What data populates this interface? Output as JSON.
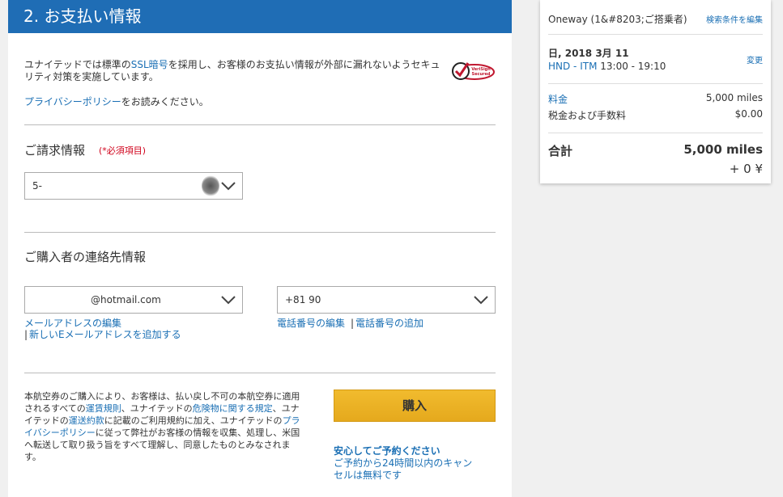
{
  "payment": {
    "header": "2. お支払い情報",
    "ssl": {
      "prefix": "ユナイテッドでは標準の",
      "link": "SSL暗号",
      "line1_suffix": "を採用し、お客様のお支払い情報が外部に漏れないようセキュ",
      "line2": "リティ対策を実施しています。"
    },
    "privacy": {
      "link": "プライバシーポリシー",
      "suffix": "をお読みください。"
    },
    "badge_text": "VeriSign Secured",
    "billing": {
      "title": "ご請求情報",
      "required_note": "(*必須項目)",
      "select_value": "5-"
    },
    "contact": {
      "title": "ご購入者の連絡先情報",
      "email_value": "@hotmail.com",
      "phone_value": "+81 90",
      "edit_email": "メールアドレスの編集",
      "add_email": "新しいEメールアドレスを追加する",
      "edit_phone": "電話番号の編集",
      "add_phone": "電話番号の追加",
      "separator": "|"
    },
    "terms": {
      "line1": "本航空券のご購入により、お客様は、払い戻し不可の本航空券に適用",
      "line2_a": "されるすべての",
      "line2_link1": "運賃規則",
      "line2_b": "、ユナイテッドの",
      "line2_link2": "危険物に関する規定",
      "line2_c": "、ユナ",
      "line3_a": "イテッドの",
      "line3_link": "運送約款",
      "line3_b": "に記載のご利用規約に加え、ユナイテッドの",
      "line3_link2": "プラ",
      "line4_link": "イバシーポリシー",
      "line4_b": "に従って弊社がお客様の情報を収集、処理し、米国",
      "line5": "へ転送して取り扱う旨をすべて理解し、同意したものとみなされま",
      "line6": "す。"
    },
    "buy_label": "購入",
    "reassure": {
      "title": "安心してご予約ください",
      "line1": "ご予約から24時間以内のキャン",
      "line2": "セルは無料です"
    }
  },
  "summary": {
    "trip_title": "Oneway (1&#8203;ご搭乗者)",
    "search_link": "検索条件を編集",
    "date": "日, 2018 3月 11",
    "route": "HND - ITM",
    "time": "13:00 - 19:10",
    "change_link": "変更",
    "fare_label": "料金",
    "fare_value": "5,000 miles",
    "tax_label": "税金および手数料",
    "tax_value": "$0.00",
    "total_label": "合計",
    "total_miles": "5,000 miles",
    "total_yen": "+ 0 ¥"
  },
  "colors": {
    "header_blue": "#1f6db5",
    "link_blue": "#1a6fb4",
    "buy_yellow": "#eab326",
    "required_red": "#d0021b"
  }
}
